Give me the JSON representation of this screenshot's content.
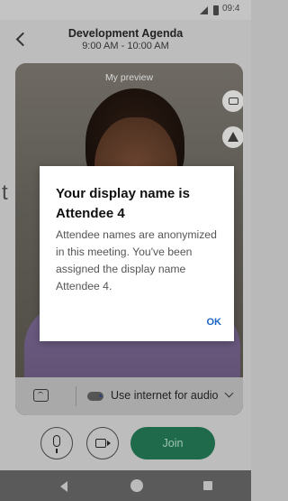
{
  "status_bar": {
    "time": "09:4"
  },
  "header": {
    "title": "Development Agenda",
    "time_range": "9:00 AM - 10:00 AM",
    "back_icon": "chevron-left-icon"
  },
  "preview": {
    "label": "My preview",
    "switch_camera_icon": "switch-camera-icon",
    "effects_icon": "background-effects-icon"
  },
  "audio_bar": {
    "option_label": "Use internet for audio"
  },
  "controls": {
    "join_label": "Join"
  },
  "overlay": {
    "stray_text": "t"
  },
  "dialog": {
    "title": "Your display name is Attendee 4",
    "body": "Attendee names are anonymized in this meeting. You've been assigned the display name Attendee 4.",
    "ok_label": "OK"
  },
  "colors": {
    "join_button": "#1f6a4a",
    "ok_link": "#1a66c2",
    "nav_bar": "#5a5a5a"
  }
}
